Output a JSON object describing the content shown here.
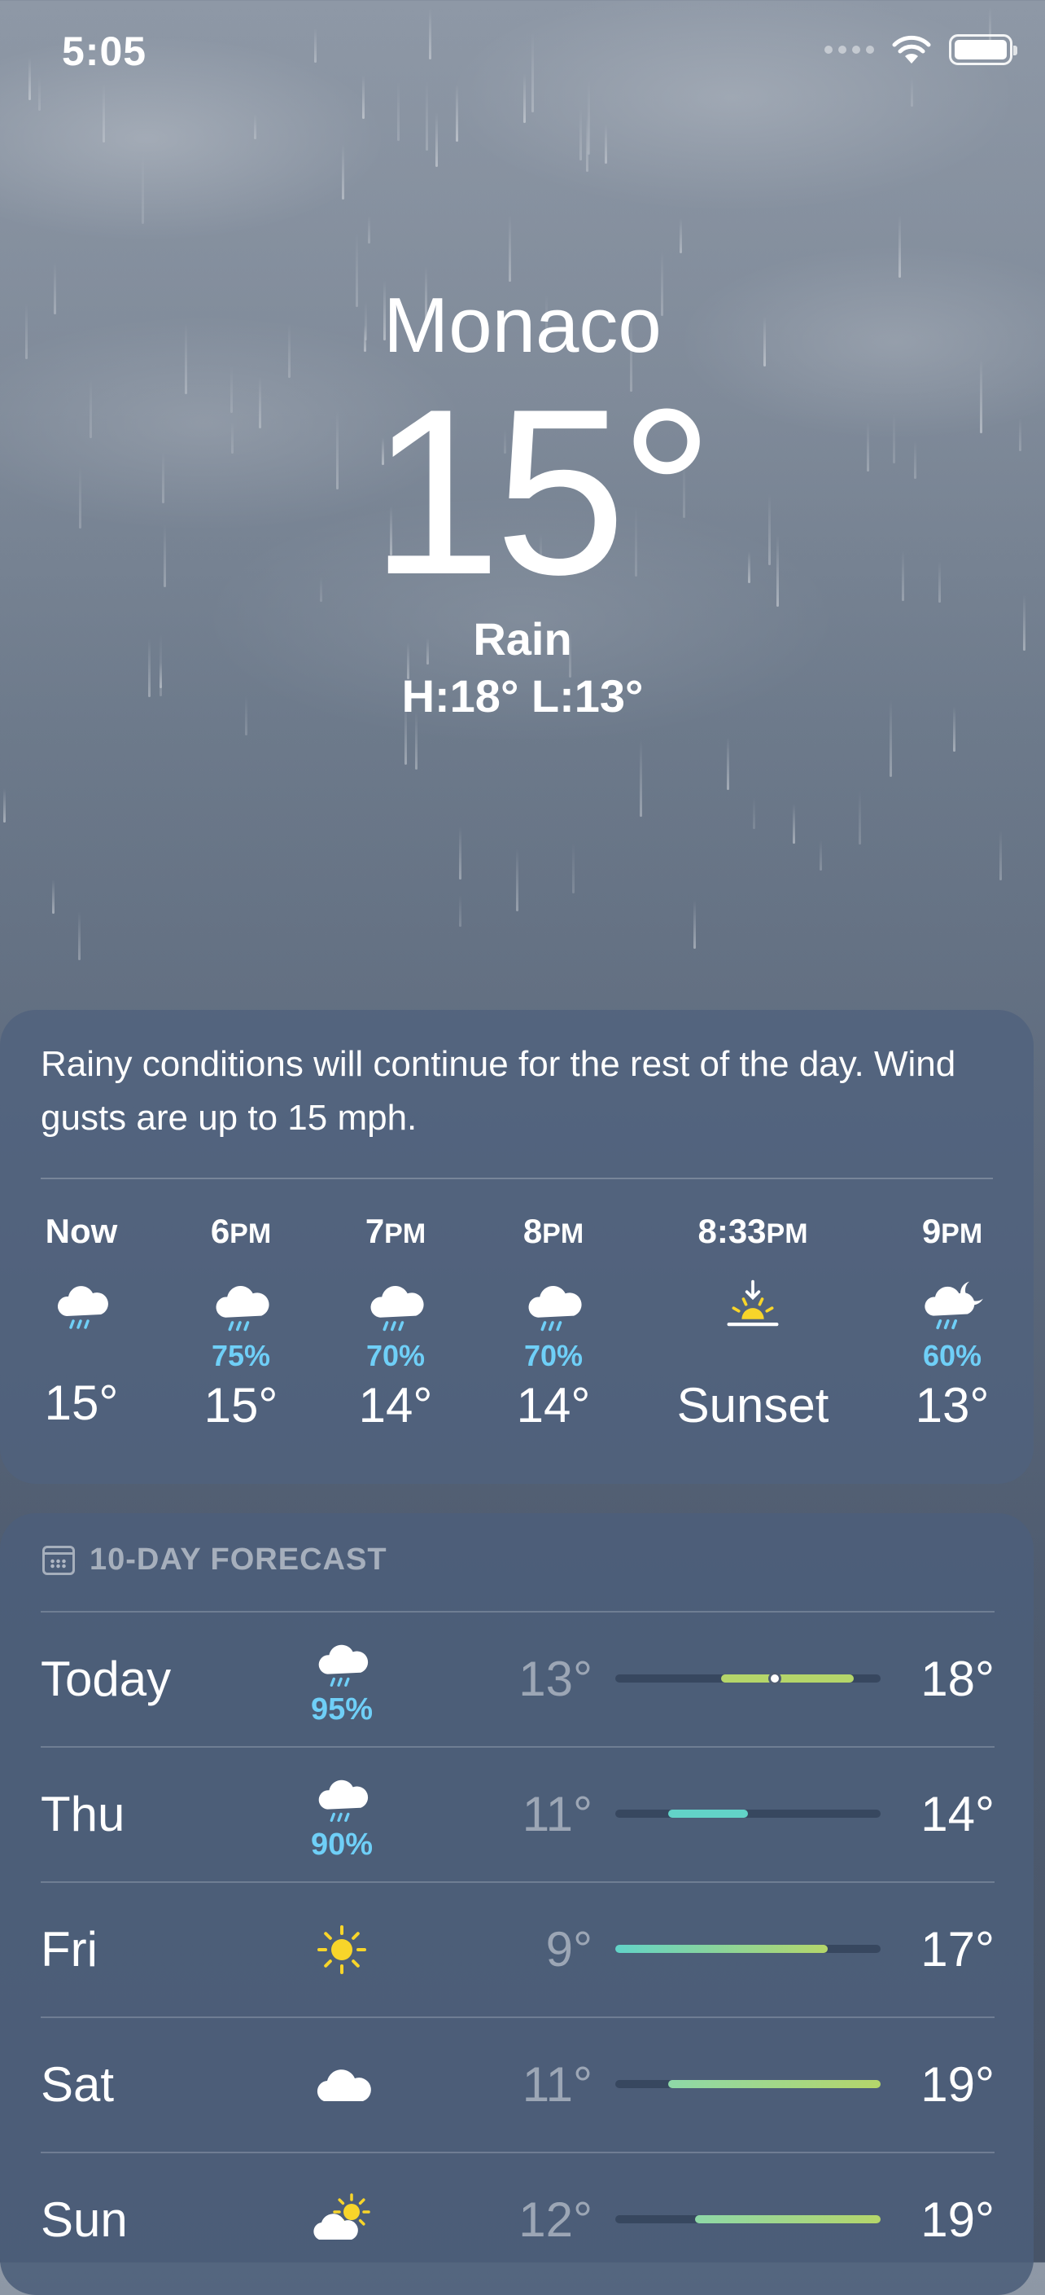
{
  "status_bar": {
    "time": "5:05",
    "icons": [
      "signal-dots-icon",
      "wifi-icon",
      "battery-icon"
    ]
  },
  "location": {
    "city": "Monaco",
    "temperature": "15°",
    "condition": "Rain",
    "high_low": "H:18°  L:13°"
  },
  "hourly": {
    "summary": "Rainy conditions will continue for the rest of the day. Wind gusts are up to 15 mph.",
    "items": [
      {
        "time": "Now",
        "ampm": "",
        "icon": "cloud-rain-icon",
        "precip": "",
        "temp": "15°"
      },
      {
        "time": "6",
        "ampm": "PM",
        "icon": "cloud-rain-icon",
        "precip": "75%",
        "temp": "15°"
      },
      {
        "time": "7",
        "ampm": "PM",
        "icon": "cloud-rain-icon",
        "precip": "70%",
        "temp": "14°"
      },
      {
        "time": "8",
        "ampm": "PM",
        "icon": "cloud-rain-icon",
        "precip": "70%",
        "temp": "14°"
      },
      {
        "time": "8:33",
        "ampm": "PM",
        "icon": "sunset-icon",
        "precip": "",
        "temp": "Sunset"
      },
      {
        "time": "9",
        "ampm": "PM",
        "icon": "cloud-moon-rain-icon",
        "precip": "60%",
        "temp": "13°"
      }
    ]
  },
  "forecast": {
    "header": "10-DAY FORECAST",
    "days": [
      {
        "day": "Today",
        "icon": "cloud-rain-icon",
        "precip": "95%",
        "low": "13°",
        "high": "18°",
        "low_value": 13,
        "high_value": 18,
        "current": 15
      },
      {
        "day": "Thu",
        "icon": "cloud-rain-icon",
        "precip": "90%",
        "low": "11°",
        "high": "14°",
        "low_value": 11,
        "high_value": 14
      },
      {
        "day": "Fri",
        "icon": "sun-icon",
        "precip": "",
        "low": "9°",
        "high": "17°",
        "low_value": 9,
        "high_value": 17
      },
      {
        "day": "Sat",
        "icon": "cloud-icon",
        "precip": "",
        "low": "11°",
        "high": "19°",
        "low_value": 11,
        "high_value": 19
      },
      {
        "day": "Sun",
        "icon": "sun-cloud-icon",
        "precip": "",
        "low": "12°",
        "high": "19°",
        "low_value": 12,
        "high_value": 19
      }
    ],
    "range_min": 9,
    "range_max": 19
  },
  "colors": {
    "precip_blue": "#6fcff7",
    "sun_yellow": "#f8d52a",
    "bar_cool": "#62d3c8",
    "bar_warm": "#b5d66a"
  }
}
